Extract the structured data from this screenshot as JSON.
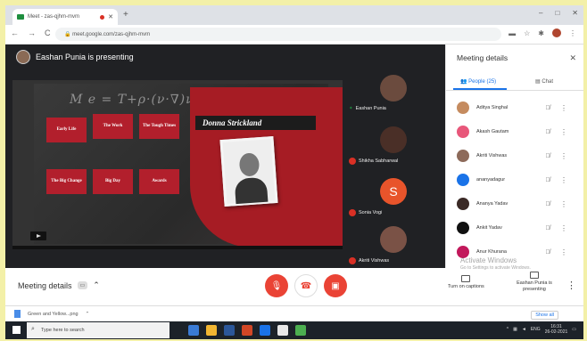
{
  "browser": {
    "tab_title": "Meet - zas-qjhm-mvm",
    "url": "meet.google.com/zas-qjhm-mvm",
    "new_tab": "+",
    "window_controls": [
      "–",
      "□",
      "✕"
    ]
  },
  "meet": {
    "presenting_label": "Eashan Punia is presenting",
    "slide": {
      "chalk_text": "M e = T+ρ·(ν·∇)ν ... (1+α)",
      "name": "Donna Strickland",
      "tiles": [
        "Early Life",
        "The Work",
        "The Tough Times",
        "The Big Change",
        "Big Day",
        "Awards"
      ]
    },
    "tiles": [
      {
        "name": "Eashan Punia",
        "type": "face",
        "color": "#6b4b3e",
        "muted": false
      },
      {
        "name": "Shikha Sabharwal",
        "type": "face",
        "color": "#4a2f27",
        "muted": true
      },
      {
        "name": "Sonia Vogi",
        "type": "initial",
        "initial": "S",
        "muted": true
      },
      {
        "name": "Akriti Vishwas",
        "type": "face",
        "color": "#7a5246",
        "muted": true
      }
    ]
  },
  "panel": {
    "title": "Meeting details",
    "tab_people": "People (25)",
    "tab_chat": "Chat",
    "participants": [
      {
        "name": "Aditya Singhal",
        "color": "#c58b5f"
      },
      {
        "name": "Akash Gautam",
        "color": "#e8577a"
      },
      {
        "name": "Akriti Vishwas",
        "color": "#8d6a5a"
      },
      {
        "name": "ananyadagur",
        "color": "#1a73e8"
      },
      {
        "name": "Ananya Yadav",
        "color": "#3b2a26"
      },
      {
        "name": "Ankit Yadav",
        "color": "#111111"
      },
      {
        "name": "Anur Khurana",
        "color": "#c2185b"
      }
    ]
  },
  "bottom": {
    "meeting_details": "Meeting details",
    "captions_label": "Turn on captions",
    "presenting_label": "Eashan Punia is presenting"
  },
  "watermark": {
    "line1": "Activate Windows",
    "line2": "Go to Settings to activate Windows."
  },
  "downloads": {
    "file": "Green and Yellow...png",
    "show_all": "Show all"
  },
  "taskbar": {
    "search_placeholder": "Type here to search",
    "lang": "ENG",
    "time": "16:31",
    "date": "26-02-2021"
  },
  "colors": {
    "meet_bg": "#202124",
    "accent_red": "#ea4335",
    "accent_blue": "#1a73e8",
    "slide_red": "#a61c24"
  }
}
